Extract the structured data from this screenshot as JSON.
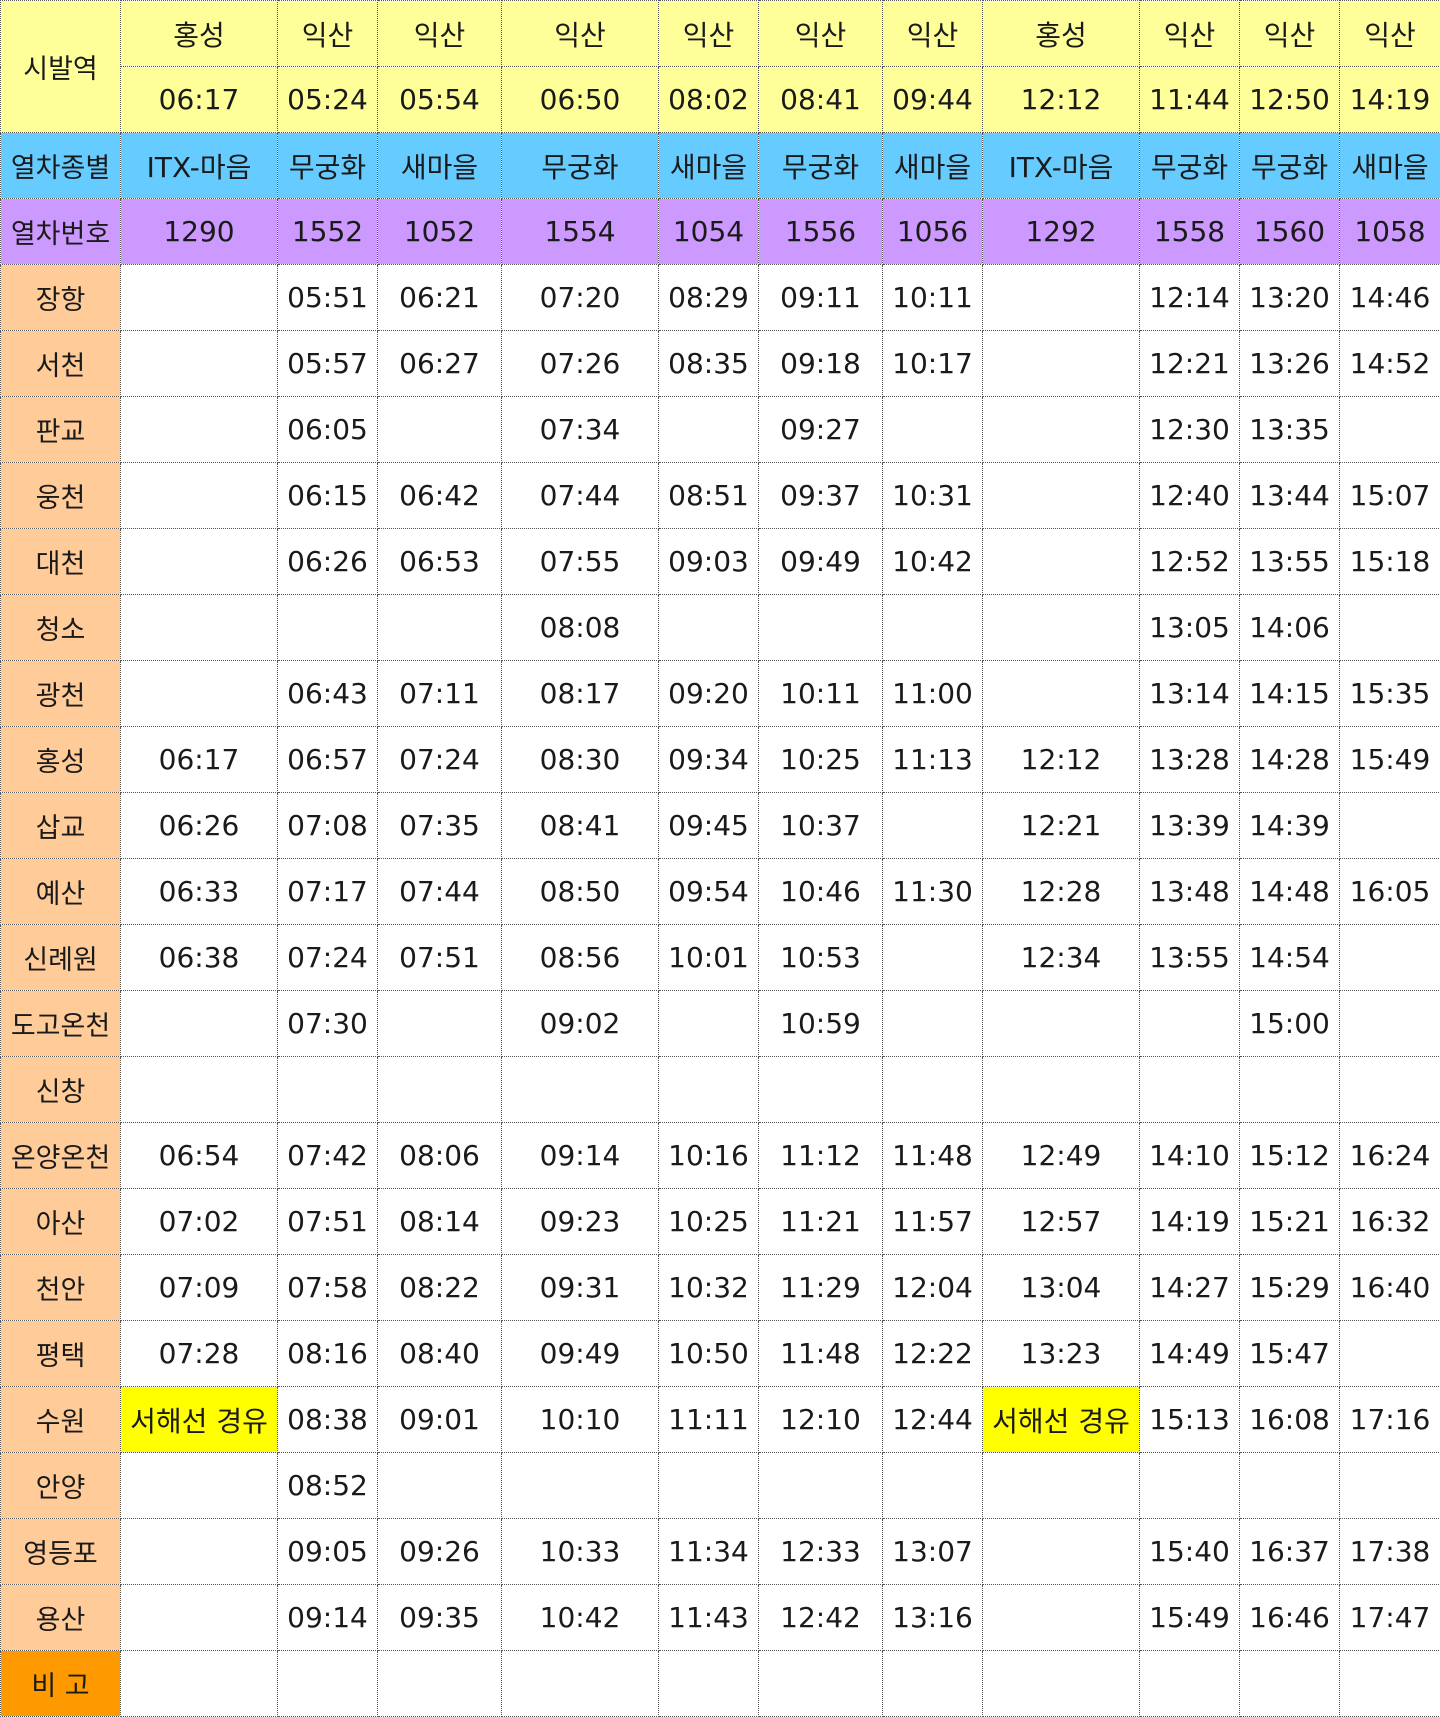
{
  "header": {
    "origin_label": "시발역",
    "type_label": "열차종별",
    "number_label": "열차번호"
  },
  "trains": [
    {
      "origin": "홍성",
      "depart": "06:17",
      "type": "ITX-마음",
      "number": "1290"
    },
    {
      "origin": "익산",
      "depart": "05:24",
      "type": "무궁화",
      "number": "1552"
    },
    {
      "origin": "익산",
      "depart": "05:54",
      "type": "새마을",
      "number": "1052"
    },
    {
      "origin": "익산",
      "depart": "06:50",
      "type": "무궁화",
      "number": "1554"
    },
    {
      "origin": "익산",
      "depart": "08:02",
      "type": "새마을",
      "number": "1054"
    },
    {
      "origin": "익산",
      "depart": "08:41",
      "type": "무궁화",
      "number": "1556"
    },
    {
      "origin": "익산",
      "depart": "09:44",
      "type": "새마을",
      "number": "1056"
    },
    {
      "origin": "홍성",
      "depart": "12:12",
      "type": "ITX-마음",
      "number": "1292"
    },
    {
      "origin": "익산",
      "depart": "11:44",
      "type": "무궁화",
      "number": "1558"
    },
    {
      "origin": "익산",
      "depart": "12:50",
      "type": "무궁화",
      "number": "1560"
    },
    {
      "origin": "익산",
      "depart": "14:19",
      "type": "새마을",
      "number": "1058"
    }
  ],
  "stations": [
    {
      "name": "장항",
      "times": [
        "",
        "05:51",
        "06:21",
        "07:20",
        "08:29",
        "09:11",
        "10:11",
        "",
        "12:14",
        "13:20",
        "14:46"
      ]
    },
    {
      "name": "서천",
      "times": [
        "",
        "05:57",
        "06:27",
        "07:26",
        "08:35",
        "09:18",
        "10:17",
        "",
        "12:21",
        "13:26",
        "14:52"
      ]
    },
    {
      "name": "판교",
      "times": [
        "",
        "06:05",
        "",
        "07:34",
        "",
        "09:27",
        "",
        "",
        "12:30",
        "13:35",
        ""
      ]
    },
    {
      "name": "웅천",
      "times": [
        "",
        "06:15",
        "06:42",
        "07:44",
        "08:51",
        "09:37",
        "10:31",
        "",
        "12:40",
        "13:44",
        "15:07"
      ]
    },
    {
      "name": "대천",
      "times": [
        "",
        "06:26",
        "06:53",
        "07:55",
        "09:03",
        "09:49",
        "10:42",
        "",
        "12:52",
        "13:55",
        "15:18"
      ]
    },
    {
      "name": "청소",
      "times": [
        "",
        "",
        "",
        "08:08",
        "",
        "",
        "",
        "",
        "13:05",
        "14:06",
        ""
      ]
    },
    {
      "name": "광천",
      "times": [
        "",
        "06:43",
        "07:11",
        "08:17",
        "09:20",
        "10:11",
        "11:00",
        "",
        "13:14",
        "14:15",
        "15:35"
      ]
    },
    {
      "name": "홍성",
      "times": [
        "06:17",
        "06:57",
        "07:24",
        "08:30",
        "09:34",
        "10:25",
        "11:13",
        "12:12",
        "13:28",
        "14:28",
        "15:49"
      ]
    },
    {
      "name": "삽교",
      "times": [
        "06:26",
        "07:08",
        "07:35",
        "08:41",
        "09:45",
        "10:37",
        "",
        "12:21",
        "13:39",
        "14:39",
        ""
      ]
    },
    {
      "name": "예산",
      "times": [
        "06:33",
        "07:17",
        "07:44",
        "08:50",
        "09:54",
        "10:46",
        "11:30",
        "12:28",
        "13:48",
        "14:48",
        "16:05"
      ]
    },
    {
      "name": "신례원",
      "times": [
        "06:38",
        "07:24",
        "07:51",
        "08:56",
        "10:01",
        "10:53",
        "",
        "12:34",
        "13:55",
        "14:54",
        ""
      ]
    },
    {
      "name": "도고온천",
      "times": [
        "",
        "07:30",
        "",
        "09:02",
        "",
        "10:59",
        "",
        "",
        "",
        "15:00",
        ""
      ]
    },
    {
      "name": "신창",
      "times": [
        "",
        "",
        "",
        "",
        "",
        "",
        "",
        "",
        "",
        "",
        ""
      ]
    },
    {
      "name": "온양온천",
      "times": [
        "06:54",
        "07:42",
        "08:06",
        "09:14",
        "10:16",
        "11:12",
        "11:48",
        "12:49",
        "14:10",
        "15:12",
        "16:24"
      ]
    },
    {
      "name": "아산",
      "times": [
        "07:02",
        "07:51",
        "08:14",
        "09:23",
        "10:25",
        "11:21",
        "11:57",
        "12:57",
        "14:19",
        "15:21",
        "16:32"
      ]
    },
    {
      "name": "천안",
      "times": [
        "07:09",
        "07:58",
        "08:22",
        "09:31",
        "10:32",
        "11:29",
        "12:04",
        "13:04",
        "14:27",
        "15:29",
        "16:40"
      ]
    },
    {
      "name": "평택",
      "times": [
        "07:28",
        "08:16",
        "08:40",
        "09:49",
        "10:50",
        "11:48",
        "12:22",
        "13:23",
        "14:49",
        "15:47",
        ""
      ]
    },
    {
      "name": "수원",
      "times": [
        "서해선 경유",
        "08:38",
        "09:01",
        "10:10",
        "11:11",
        "12:10",
        "12:44",
        "서해선 경유",
        "15:13",
        "16:08",
        "17:16"
      ]
    },
    {
      "name": "안양",
      "times": [
        "",
        "08:52",
        "",
        "",
        "",
        "",
        "",
        "",
        "",
        "",
        ""
      ]
    },
    {
      "name": "영등포",
      "times": [
        "",
        "09:05",
        "09:26",
        "10:33",
        "11:34",
        "12:33",
        "13:07",
        "",
        "15:40",
        "16:37",
        "17:38"
      ]
    },
    {
      "name": "용산",
      "times": [
        "",
        "09:14",
        "09:35",
        "10:42",
        "11:43",
        "12:42",
        "13:16",
        "",
        "15:49",
        "16:46",
        "17:47"
      ]
    }
  ],
  "remarks": {
    "label": "비 고",
    "values": [
      "",
      "",
      "",
      "",
      "",
      "",
      "",
      "",
      "",
      "",
      ""
    ]
  },
  "colors": {
    "origin_row": "#ffff99",
    "type_row": "#66ccff",
    "number_row": "#cc99ff",
    "station_col": "#ffcc99",
    "remark_label": "#ff9900",
    "via_highlight": "#ffff00"
  }
}
